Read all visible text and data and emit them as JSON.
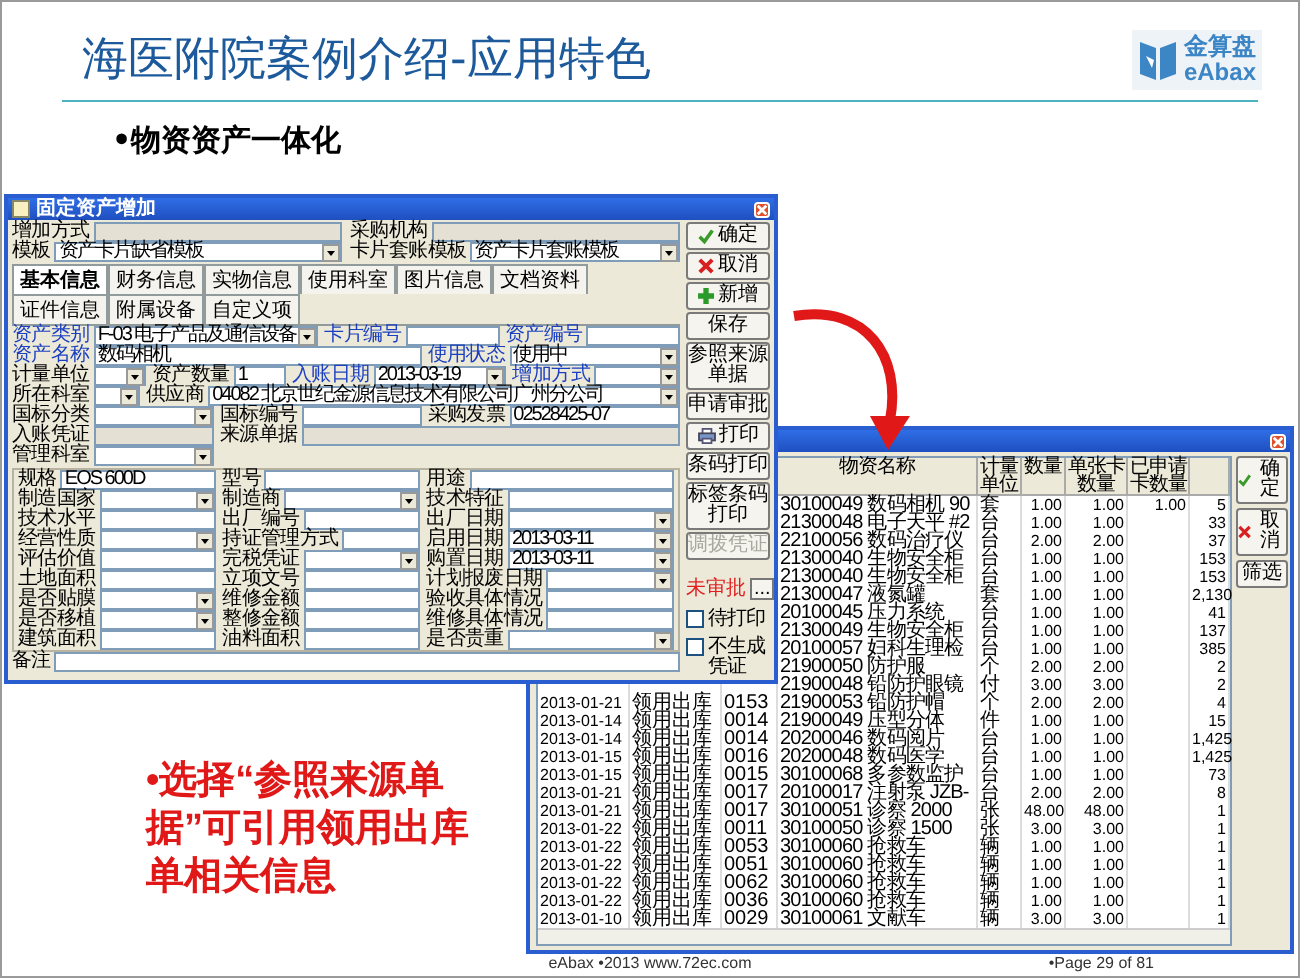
{
  "slide": {
    "title": "海医附院案例介绍-应用特色",
    "logo": {
      "top": "金算盘",
      "bottom": "eAbax"
    },
    "bullet": "•物资资产一体化",
    "note": "•选择“参照来源单据”可引用领用出库单相关信息",
    "footer": {
      "center": "eAbax •2013 www.72ec.com",
      "page": "•Page 29 of 81"
    }
  },
  "asset_dialog": {
    "title": "固定资产增加",
    "top_fields": [
      {
        "label": "增加方式",
        "kind": "readonly",
        "required": false
      },
      {
        "label": "采购机构",
        "kind": "readonly",
        "required": false
      },
      {
        "label": "模板",
        "kind": "combo",
        "required": false,
        "value": "资产卡片缺省模板"
      },
      {
        "label": "卡片套账模板",
        "kind": "combo",
        "required": false,
        "value": "资产卡片套账模板"
      }
    ],
    "tabs": [
      {
        "label": "基本信息",
        "selected": true
      },
      {
        "label": "财务信息",
        "selected": false
      },
      {
        "label": "实物信息",
        "selected": false
      },
      {
        "label": "使用科室",
        "selected": false
      },
      {
        "label": "图片信息",
        "selected": false
      },
      {
        "label": "文档资料",
        "selected": false
      },
      {
        "label": "证件信息",
        "selected": false
      },
      {
        "label": "附属设备",
        "selected": false
      },
      {
        "label": "自定义项",
        "selected": false
      }
    ],
    "main_rows": [
      [
        {
          "label": "资产类别",
          "kind": "combo",
          "required": true,
          "value": "F-03 电子产品及通信设备"
        },
        {
          "label": "卡片编号",
          "kind": "text",
          "required": true
        },
        {
          "label": "资产编号",
          "kind": "text",
          "required": true
        }
      ],
      [
        {
          "label": "资产名称",
          "kind": "text",
          "required": true,
          "wide": true,
          "value": "数码相机"
        },
        {
          "label": "使用状态",
          "kind": "combo",
          "required": true,
          "value": "使用中"
        }
      ],
      [
        {
          "label": "计量单位",
          "kind": "combo",
          "required": false
        },
        {
          "label": "资产数量",
          "kind": "text",
          "required": false,
          "value": "1"
        },
        {
          "label": "入账日期",
          "kind": "combo",
          "required": true,
          "value": "2013-03-19"
        },
        {
          "label": "增加方式",
          "kind": "combo",
          "required": true
        }
      ],
      [
        {
          "label": "所在科室",
          "kind": "combo",
          "required": false
        },
        {
          "label": "供应商",
          "kind": "combo",
          "required": false,
          "wide": true,
          "value": "04082 北京世纪金源信息技术有限公司广州分公司"
        }
      ],
      [
        {
          "label": "国标分类",
          "kind": "combo",
          "required": false
        },
        {
          "label": "国标编号",
          "kind": "text",
          "required": false
        },
        {
          "label": "采购发票",
          "kind": "text",
          "required": false,
          "value": "02528425-07"
        }
      ],
      [
        {
          "label": "入账凭证",
          "kind": "readonly",
          "required": false
        },
        {
          "label": "来源单据",
          "kind": "readonly",
          "required": false,
          "wide": true
        }
      ],
      [
        {
          "label": "管理科室",
          "kind": "combo",
          "required": false
        }
      ]
    ],
    "sub_rows": [
      [
        {
          "label": "规格",
          "kind": "text",
          "required": false,
          "value": "EOS 600D"
        },
        {
          "label": "型号",
          "kind": "text",
          "required": false
        },
        {
          "label": "用途",
          "kind": "text",
          "required": false
        }
      ],
      [
        {
          "label": "制造国家",
          "kind": "combo",
          "required": false
        },
        {
          "label": "制造商",
          "kind": "combo",
          "required": false
        },
        {
          "label": "技术特征",
          "kind": "text",
          "required": false
        }
      ],
      [
        {
          "label": "技术水平",
          "kind": "text",
          "required": false
        },
        {
          "label": "出厂编号",
          "kind": "text",
          "required": false
        },
        {
          "label": "出厂日期",
          "kind": "combo",
          "required": false
        }
      ],
      [
        {
          "label": "经营性质",
          "kind": "combo",
          "required": false
        },
        {
          "label": "持证管理方式",
          "kind": "text",
          "required": false
        },
        {
          "label": "启用日期",
          "kind": "combo",
          "required": false,
          "value": "2013-03-11"
        }
      ],
      [
        {
          "label": "评估价值",
          "kind": "text",
          "required": false
        },
        {
          "label": "完税凭证",
          "kind": "combo",
          "required": false
        },
        {
          "label": "购置日期",
          "kind": "combo",
          "required": false,
          "value": "2013-03-11"
        }
      ],
      [
        {
          "label": "土地面积",
          "kind": "text",
          "required": false
        },
        {
          "label": "立项文号",
          "kind": "text",
          "required": false
        },
        {
          "label": "计划报废日期",
          "kind": "combo",
          "required": false
        }
      ],
      [
        {
          "label": "是否贴膜",
          "kind": "combo",
          "required": false
        },
        {
          "label": "维修金额",
          "kind": "text",
          "required": false
        },
        {
          "label": "验收具体情况",
          "kind": "text",
          "required": false
        }
      ],
      [
        {
          "label": "是否移植",
          "kind": "combo",
          "required": false
        },
        {
          "label": "整修金额",
          "kind": "text",
          "required": false
        },
        {
          "label": "维修具体情况",
          "kind": "text",
          "required": false
        }
      ],
      [
        {
          "label": "建筑面积",
          "kind": "text",
          "required": false
        },
        {
          "label": "油料面积",
          "kind": "text",
          "required": false
        },
        {
          "label": "是否贵重",
          "kind": "combo",
          "required": false
        }
      ]
    ],
    "remark": {
      "label": "备注",
      "kind": "text",
      "required": false
    },
    "buttons": [
      {
        "label": "确定",
        "disabled": false
      },
      {
        "label": "取消",
        "disabled": false
      },
      {
        "label": "新增",
        "disabled": false
      },
      {
        "label": "保存",
        "disabled": false
      },
      {
        "label": "参照来源单据",
        "disabled": false
      },
      {
        "label": "申请审批",
        "disabled": false
      },
      {
        "label": "打印",
        "disabled": false
      },
      {
        "label": "条码打印",
        "disabled": false
      },
      {
        "label": "标签条码打印",
        "disabled": false
      },
      {
        "label": "调拨凭证",
        "disabled": true
      }
    ],
    "status": "未审批",
    "browse": "...",
    "checkboxes": [
      {
        "label": "待打印",
        "checked": false
      },
      {
        "label": "不生成凭证",
        "checked": false
      }
    ]
  },
  "pick_dialog": {
    "columns": [
      "物资名称",
      "计量单位",
      "数量",
      "单张卡数量",
      "已申请卡数量"
    ],
    "rows": [
      {
        "name": "30100049 数码相机 90",
        "unit": "套",
        "qty": "1.00",
        "card_qty": "1.00",
        "applied_qty": "1.00",
        "column_9": "5"
      },
      {
        "name": "21300048 电子天平 #2",
        "unit": "台",
        "qty": "1.00",
        "card_qty": "1.00",
        "column_9": "33"
      },
      {
        "name": "22100056 数码治疗仪",
        "unit": "台",
        "qty": "2.00",
        "card_qty": "2.00",
        "column_9": "37"
      },
      {
        "name": "21300040 生物安全柜",
        "unit": "台",
        "qty": "1.00",
        "card_qty": "1.00",
        "column_9": "153"
      },
      {
        "name": "21300040 生物安全柜",
        "unit": "台",
        "qty": "1.00",
        "card_qty": "1.00",
        "column_9": "153"
      },
      {
        "name": "21300047 液氮罐",
        "unit": "套",
        "qty": "1.00",
        "card_qty": "1.00",
        "column_9": "2,130"
      },
      {
        "name": "20100045 压力系统",
        "unit": "台",
        "qty": "1.00",
        "card_qty": "1.00",
        "column_9": "41"
      },
      {
        "name": "21300049 生物安全柜",
        "unit": "台",
        "qty": "1.00",
        "card_qty": "1.00",
        "column_9": "137"
      },
      {
        "name": "20100057 妇科生理检",
        "unit": "台",
        "qty": "1.00",
        "card_qty": "1.00",
        "column_9": "385"
      },
      {
        "name": "21900050 防护服",
        "unit": "个",
        "qty": "2.00",
        "card_qty": "2.00",
        "column_9": "2"
      },
      {
        "name": "21900048 铅防护眼镜",
        "unit": "付",
        "qty": "3.00",
        "card_qty": "3.00",
        "column_9": "2"
      },
      {
        "column_1": "2013-01-21",
        "column_2": "领用出库",
        "column_3": "0153",
        "name": "21900053 铅防护帽",
        "unit": "个",
        "qty": "2.00",
        "card_qty": "2.00",
        "column_9": "4"
      },
      {
        "column_1": "2013-01-14",
        "column_2": "领用出库",
        "column_3": "0014",
        "name": "21900049 压型分体",
        "unit": "件",
        "qty": "1.00",
        "card_qty": "1.00",
        "column_9": "15"
      },
      {
        "column_1": "2013-01-14",
        "column_2": "领用出库",
        "column_3": "0014",
        "name": "20200046 数码阅片",
        "unit": "台",
        "qty": "1.00",
        "card_qty": "1.00",
        "column_9": "1,425"
      },
      {
        "column_1": "2013-01-15",
        "column_2": "领用出库",
        "column_3": "0016",
        "name": "20200048 数码医学",
        "unit": "台",
        "qty": "1.00",
        "card_qty": "1.00",
        "column_9": "1,425"
      },
      {
        "column_1": "2013-01-15",
        "column_2": "领用出库",
        "column_3": "0015",
        "name": "30100068 多参数监护",
        "unit": "台",
        "qty": "1.00",
        "card_qty": "1.00",
        "column_9": "73"
      },
      {
        "column_1": "2013-01-21",
        "column_2": "领用出库",
        "column_3": "0017",
        "name": "20100017 注射泵 JZB-",
        "unit": "台",
        "qty": "2.00",
        "card_qty": "2.00",
        "column_9": "8"
      },
      {
        "column_1": "2013-01-21",
        "column_2": "领用出库",
        "column_3": "0017",
        "name": "30100051 诊察 2000",
        "unit": "张",
        "qty": "48.00",
        "card_qty": "48.00",
        "column_9": "1"
      },
      {
        "column_1": "2013-01-22",
        "column_2": "领用出库",
        "column_3": "0011",
        "name": "30100050 诊察 1500",
        "unit": "张",
        "qty": "3.00",
        "card_qty": "3.00",
        "column_9": "1"
      },
      {
        "column_1": "2013-01-22",
        "column_2": "领用出库",
        "column_3": "0053",
        "name": "30100060 抢救车",
        "unit": "辆",
        "qty": "1.00",
        "card_qty": "1.00",
        "column_9": "1"
      },
      {
        "column_1": "2013-01-22",
        "column_2": "领用出库",
        "column_3": "0051",
        "name": "30100060 抢救车",
        "unit": "辆",
        "qty": "1.00",
        "card_qty": "1.00",
        "column_9": "1"
      },
      {
        "column_1": "2013-01-22",
        "column_2": "领用出库",
        "column_3": "0062",
        "name": "30100060 抢救车",
        "unit": "辆",
        "qty": "1.00",
        "card_qty": "1.00",
        "column_9": "1"
      },
      {
        "column_1": "2013-01-22",
        "column_2": "领用出库",
        "column_3": "0036",
        "name": "30100060 抢救车",
        "unit": "辆",
        "qty": "1.00",
        "card_qty": "1.00",
        "column_9": "1"
      },
      {
        "column_1": "2013-01-10",
        "column_2": "领用出库",
        "column_3": "0029",
        "name": "30100061 文献车",
        "unit": "辆",
        "qty": "3.00",
        "card_qty": "3.00",
        "column_9": "1"
      }
    ],
    "buttons": [
      {
        "label": "确定"
      },
      {
        "label": "取消"
      },
      {
        "label": "筛选"
      }
    ]
  }
}
